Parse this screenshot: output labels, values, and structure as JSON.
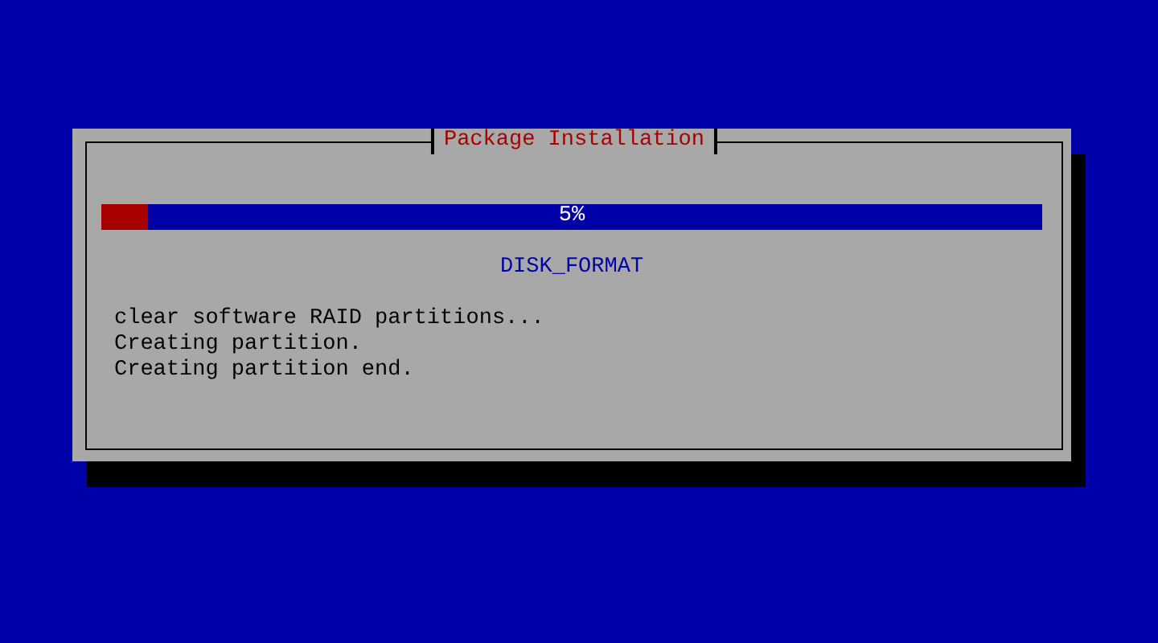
{
  "dialog": {
    "title": "Package Installation",
    "progress": {
      "level": 0.05,
      "reading": "5%"
    },
    "stage": "DISK_FORMAT",
    "log": [
      "clear software RAID partitions...",
      "Creating partition.",
      "Creating partition end."
    ]
  }
}
